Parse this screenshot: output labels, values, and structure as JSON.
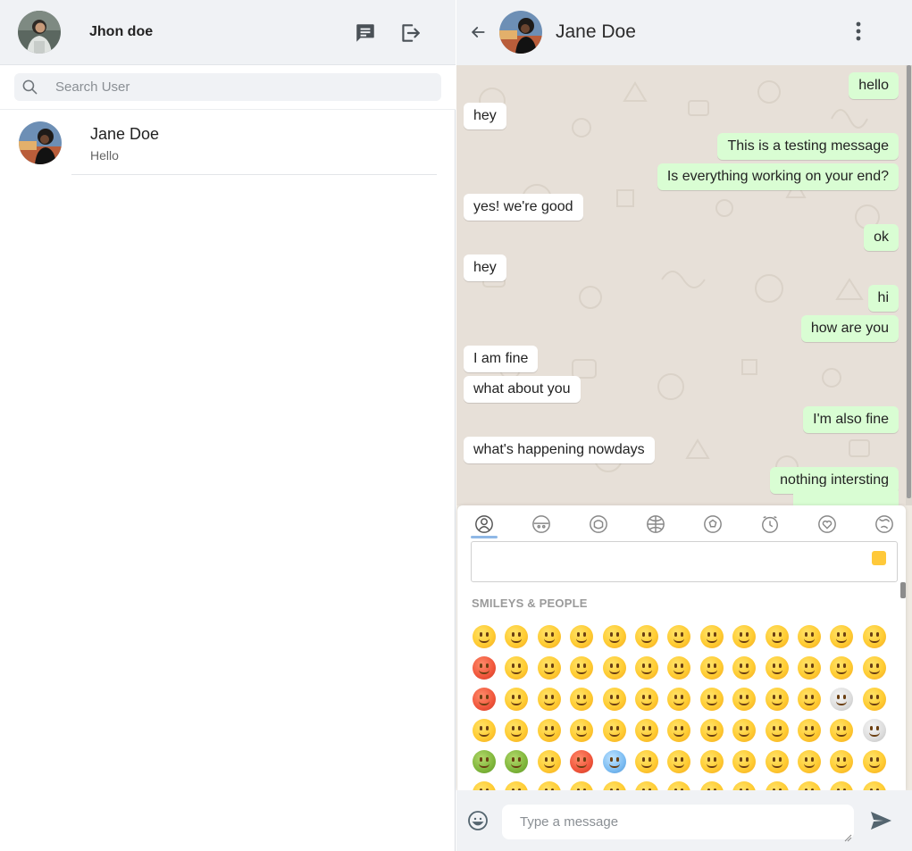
{
  "sidebar": {
    "user": {
      "name": "Jhon doe",
      "avatar": "user-avatar-photo"
    },
    "actions": {
      "new_chat_icon": "chat-icon",
      "logout_icon": "logout-icon"
    },
    "search": {
      "placeholder": "Search User",
      "value": ""
    },
    "contacts": [
      {
        "name": "Jane Doe",
        "last_message": "Hello",
        "avatar": "contact-avatar-photo"
      }
    ]
  },
  "chat": {
    "contact_name": "Jane Doe",
    "back_icon": "back-arrow-icon",
    "menu_icon": "more-vert-icon",
    "messages": [
      {
        "from": "out",
        "text": "hello"
      },
      {
        "from": "in",
        "text": "hey"
      },
      {
        "from": "out",
        "text": "This is a testing message"
      },
      {
        "from": "out",
        "text": "Is everything working on your end?"
      },
      {
        "from": "in",
        "text": "yes! we're good"
      },
      {
        "from": "out",
        "text": "ok"
      },
      {
        "from": "in",
        "text": "hey"
      },
      {
        "from": "out",
        "text": "hi"
      },
      {
        "from": "out",
        "text": "how are you"
      },
      {
        "from": "in",
        "text": "I am fine"
      },
      {
        "from": "in",
        "text": "what about you"
      },
      {
        "from": "out",
        "text": "I'm also fine"
      },
      {
        "from": "in",
        "text": "what's happening nowdays"
      },
      {
        "from": "out",
        "text": "nothing intersting"
      }
    ]
  },
  "emoji_picker": {
    "categories": [
      "smileys-people-icon",
      "animals-nature-icon",
      "food-drink-icon",
      "travel-places-icon",
      "activities-icon",
      "objects-icon",
      "symbols-icon",
      "flags-icon"
    ],
    "active_category": "smileys-people-icon",
    "search_value": "",
    "skin_tone_color": "#ffc93a",
    "section_label": "SMILEYS & PEOPLE"
  },
  "composer": {
    "placeholder": "Type a message",
    "value": "",
    "emoji_icon": "emoji-icon",
    "send_icon": "send-icon"
  },
  "colors": {
    "incoming_bubble": "#ffffff",
    "outgoing_bubble": "#d9fdd3",
    "header_bg": "#f0f2f5",
    "chat_bg": "#e7e0d8"
  }
}
